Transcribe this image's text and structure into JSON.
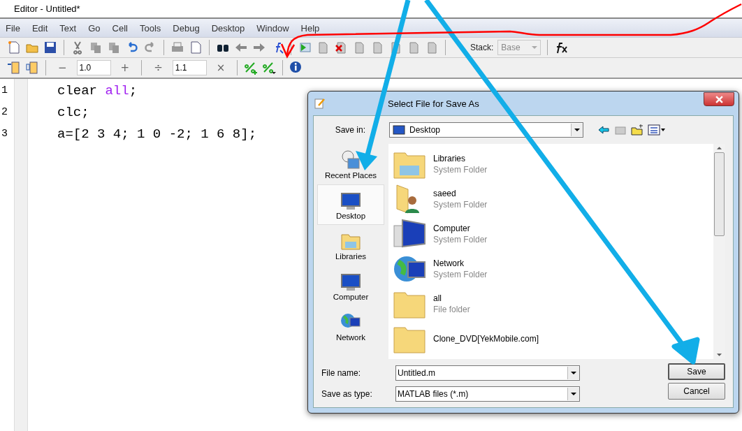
{
  "editor": {
    "title": "Editor - Untitled*",
    "menu": [
      "File",
      "Edit",
      "Text",
      "Go",
      "Cell",
      "Tools",
      "Debug",
      "Desktop",
      "Window",
      "Help"
    ],
    "toolbar": {
      "stack_label": "Stack:",
      "stack_value": "Base"
    },
    "cell_toolbar": {
      "decrement": "−",
      "value_1": "1.0",
      "increment": "+",
      "divide": "÷",
      "value_2": "1.1",
      "multiply": "×"
    },
    "lines": [
      {
        "number": "1",
        "tokens": [
          {
            "text": "clear ",
            "kind": "plain"
          },
          {
            "text": "all",
            "kind": "string"
          },
          {
            "text": ";",
            "kind": "plain"
          }
        ]
      },
      {
        "number": "2",
        "tokens": [
          {
            "text": "clc;",
            "kind": "plain"
          }
        ]
      },
      {
        "number": "3",
        "tokens": [
          {
            "text": "a=[2 3 4; 1 0 -2; 1 6 8];",
            "kind": "plain"
          }
        ]
      }
    ]
  },
  "dialog": {
    "title": "Select File for Save As",
    "save_in_label": "Save in:",
    "save_in_value": "Desktop",
    "places": [
      {
        "label": "Recent Places",
        "selected": false
      },
      {
        "label": "Desktop",
        "selected": true
      },
      {
        "label": "Libraries",
        "selected": false
      },
      {
        "label": "Computer",
        "selected": false
      },
      {
        "label": "Network",
        "selected": false
      }
    ],
    "files": [
      {
        "name": "Libraries",
        "type": "System Folder"
      },
      {
        "name": "saeed",
        "type": "System Folder"
      },
      {
        "name": "Computer",
        "type": "System Folder"
      },
      {
        "name": "Network",
        "type": "System Folder"
      },
      {
        "name": "all",
        "type": "File folder"
      },
      {
        "name": "Clone_DVD[YekMobile.com]"
      }
    ],
    "file_name_label": "File name:",
    "file_name": "Untitled.m",
    "type_label": "Save as type:",
    "type_value": "MATLAB files (*.m)",
    "buttons": [
      "Save",
      "Cancel"
    ]
  }
}
